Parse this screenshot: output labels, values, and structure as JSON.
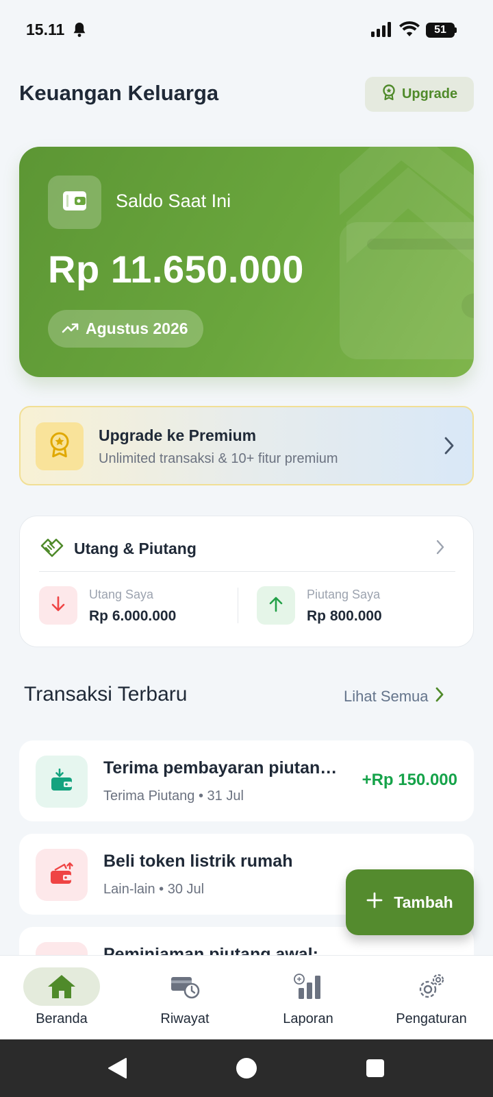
{
  "status_bar": {
    "time": "15.11",
    "battery": "51"
  },
  "header": {
    "title": "Keuangan Keluarga",
    "upgrade_label": "Upgrade"
  },
  "balance": {
    "label": "Saldo Saat Ini",
    "amount": "Rp 11.650.000",
    "period": "Agustus 2026"
  },
  "premium": {
    "title": "Upgrade ke Premium",
    "subtitle": "Unlimited transaksi & 10+ fitur premium"
  },
  "debt": {
    "title": "Utang & Piutang",
    "payable_label": "Utang Saya",
    "payable_value": "Rp 6.000.000",
    "receivable_label": "Piutang Saya",
    "receivable_value": "Rp 800.000"
  },
  "transactions": {
    "title": "Transaksi Terbaru",
    "see_all": "Lihat Semua",
    "items": [
      {
        "title": "Terima pembayaran piutan…",
        "category": "Terima Piutang",
        "date": "31 Jul",
        "amount": "+Rp 150.000"
      },
      {
        "title": "Beli token listrik rumah",
        "category": "Lain-lain",
        "date": "30 Jul",
        "amount": ""
      },
      {
        "title": "Peminjaman piutang awal:",
        "category": "",
        "date": "",
        "amount": ""
      }
    ]
  },
  "fab": {
    "label": "Tambah"
  },
  "bottom_nav": {
    "items": [
      {
        "label": "Beranda",
        "icon": "home-icon",
        "active": true
      },
      {
        "label": "Riwayat",
        "icon": "history-icon",
        "active": false
      },
      {
        "label": "Laporan",
        "icon": "report-icon",
        "active": false
      },
      {
        "label": "Pengaturan",
        "icon": "settings-icon",
        "active": false
      }
    ]
  },
  "colors": {
    "primary": "#548b2e",
    "card_green": "#6aa63d",
    "income": "#16a34a",
    "expense": "#ef4444",
    "background": "#f3f6f9"
  }
}
